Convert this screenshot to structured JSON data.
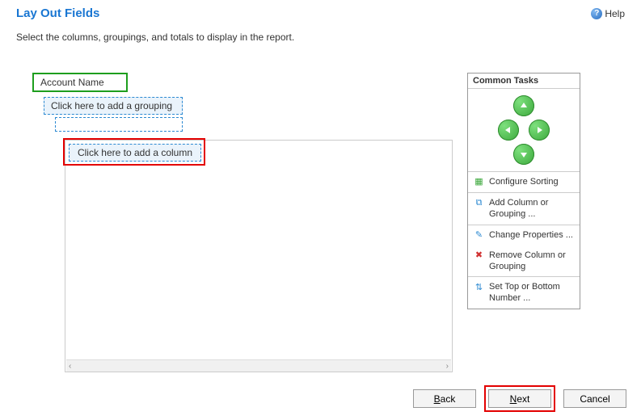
{
  "header": {
    "title": "Lay Out Fields",
    "help_label": "Help"
  },
  "instruction": "Select the columns, groupings, and totals to display in the report.",
  "fields": {
    "account_name": "Account Name",
    "add_grouping": "Click here to add a grouping",
    "add_column": "Click here to add a column"
  },
  "common_tasks": {
    "header": "Common Tasks",
    "configure_sorting": "Configure Sorting",
    "add_column_grouping": "Add Column or Grouping ...",
    "change_properties": "Change Properties ...",
    "remove_column_grouping": "Remove Column or Grouping",
    "set_top_bottom": "Set Top or Bottom Number ..."
  },
  "buttons": {
    "back": "Back",
    "next": "Next",
    "cancel": "Cancel"
  }
}
